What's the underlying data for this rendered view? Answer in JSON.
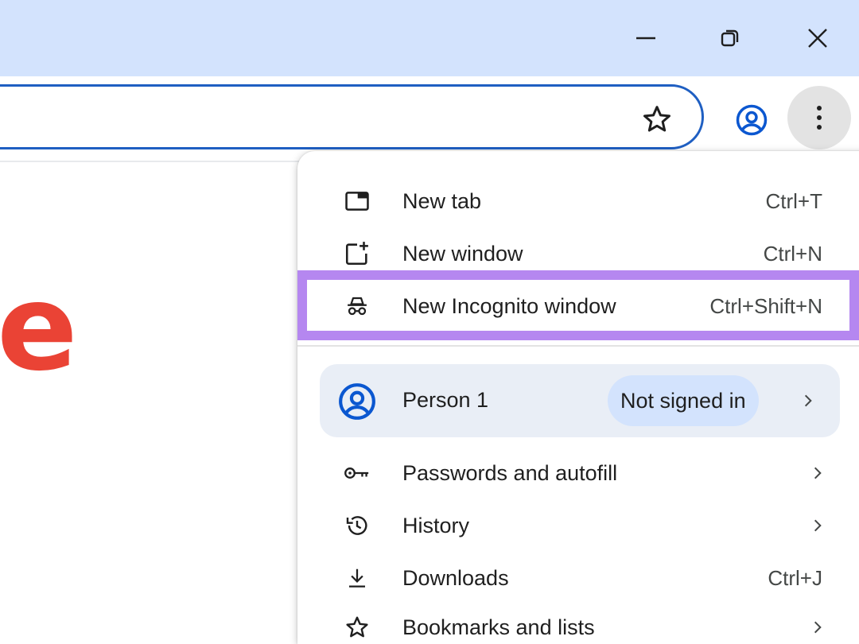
{
  "window_controls": {
    "minimize_icon": "minimize-icon",
    "restore_icon": "restore-icon",
    "close_icon": "close-icon"
  },
  "toolbar": {
    "bookmark_icon": "star-icon",
    "profile_icon": "account-circle-icon",
    "menu_icon": "more-vert-icon"
  },
  "page": {
    "logo_fragment": "e"
  },
  "menu": {
    "items_top": [
      {
        "label": "New tab",
        "shortcut": "Ctrl+T",
        "icon": "new-tab-icon"
      },
      {
        "label": "New window",
        "shortcut": "Ctrl+N",
        "icon": "new-window-icon"
      },
      {
        "label": "New Incognito window",
        "shortcut": "Ctrl+Shift+N",
        "icon": "incognito-icon"
      }
    ],
    "person": {
      "name": "Person 1",
      "status": "Not signed in",
      "icon": "account-circle-icon"
    },
    "items_bottom": [
      {
        "label": "Passwords and autofill",
        "icon": "key-icon"
      },
      {
        "label": "History",
        "icon": "history-icon"
      },
      {
        "label": "Downloads",
        "shortcut": "Ctrl+J",
        "icon": "download-icon"
      },
      {
        "label": "Bookmarks and lists",
        "icon": "star-icon"
      }
    ]
  },
  "colors": {
    "titlebar": "#d3e3fd",
    "omnibox_border": "#1f5fc2",
    "highlight": "#b587f0",
    "person_card": "#e9eef6",
    "badge": "#d3e3fd",
    "profile_blue": "#0b57d0",
    "logo_red": "#ea4335"
  }
}
